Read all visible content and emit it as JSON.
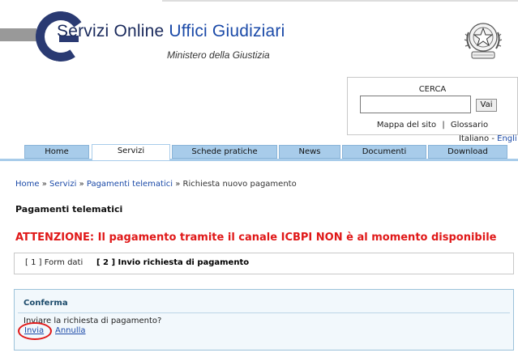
{
  "header": {
    "brand_part1": "Servizi Online",
    "brand_part2": "Uffici Giudiziari",
    "ministry": "Ministero della Giustizia"
  },
  "search": {
    "title": "CERCA",
    "button_label": "Vai",
    "input_value": "",
    "sitemap_link": "Mappa del sito",
    "separator": "|",
    "glossary_link": "Glossario"
  },
  "language": {
    "current": "Italiano",
    "separator": "-",
    "other": "Engli"
  },
  "nav": {
    "items": [
      {
        "label": "Home"
      },
      {
        "label": "Servizi"
      },
      {
        "label": "Schede pratiche"
      },
      {
        "label": "News"
      },
      {
        "label": "Documenti"
      },
      {
        "label": "Download"
      }
    ],
    "active_index": 1
  },
  "breadcrumb": {
    "items": [
      "Home",
      "Servizi",
      "Pagamenti telematici"
    ],
    "current": "Richiesta nuovo pagamento",
    "separator": "»"
  },
  "page": {
    "title": "Pagamenti telematici",
    "warning": "ATTENZIONE: Il pagamento tramite il canale ICBPI NON è al momento disponibile"
  },
  "steps": {
    "items": [
      {
        "label": "[ 1 ] Form dati",
        "current": false
      },
      {
        "label": "[ 2 ] Invio richiesta di pagamento",
        "current": true
      }
    ]
  },
  "confirm": {
    "title": "Conferma",
    "question": "Inviare la richiesta di pagamento?",
    "submit_label": "Invia",
    "cancel_label": "Annulla"
  },
  "colors": {
    "nav_tab": "#a8ccea",
    "link": "#1b4aa8",
    "warning": "#e01818",
    "brand_dark": "#2a3a72",
    "confirm_bg": "#f2f8fc"
  },
  "icons": {
    "logo": "g-logo-icon",
    "emblem": "italian-republic-emblem-icon"
  }
}
